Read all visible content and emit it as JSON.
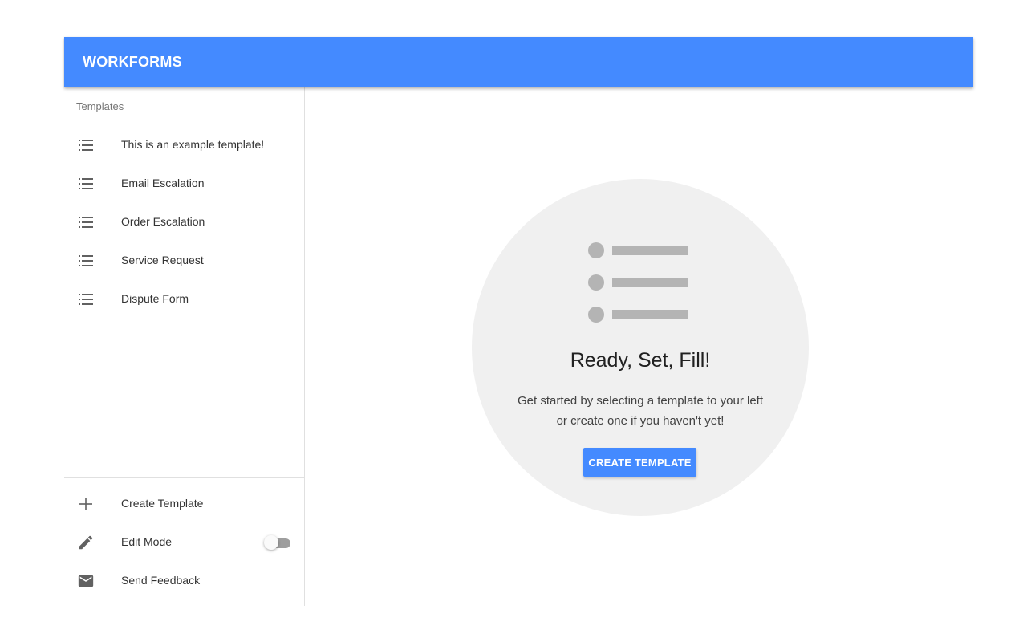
{
  "app": {
    "title": "WORKFORMS",
    "brand_color": "#448aff"
  },
  "sidebar": {
    "subheader": "Templates",
    "templates": [
      {
        "label": "This is an example template!",
        "icon": "list-icon"
      },
      {
        "label": "Email Escalation",
        "icon": "list-icon"
      },
      {
        "label": "Order Escalation",
        "icon": "list-icon"
      },
      {
        "label": "Service Request",
        "icon": "list-icon"
      },
      {
        "label": "Dispute Form",
        "icon": "list-icon"
      }
    ],
    "actions": {
      "create_template": {
        "label": "Create Template",
        "icon": "plus-icon"
      },
      "edit_mode": {
        "label": "Edit Mode",
        "icon": "pencil-icon",
        "enabled": false
      },
      "send_feedback": {
        "label": "Send Feedback",
        "icon": "mail-icon"
      }
    }
  },
  "main": {
    "empty_state": {
      "illustration": "list-illustration",
      "title": "Ready, Set, Fill!",
      "text_line1": "Get started by selecting a template to your left",
      "text_line2": "or create one if you haven't yet!",
      "button_label": "CREATE TEMPLATE"
    }
  }
}
